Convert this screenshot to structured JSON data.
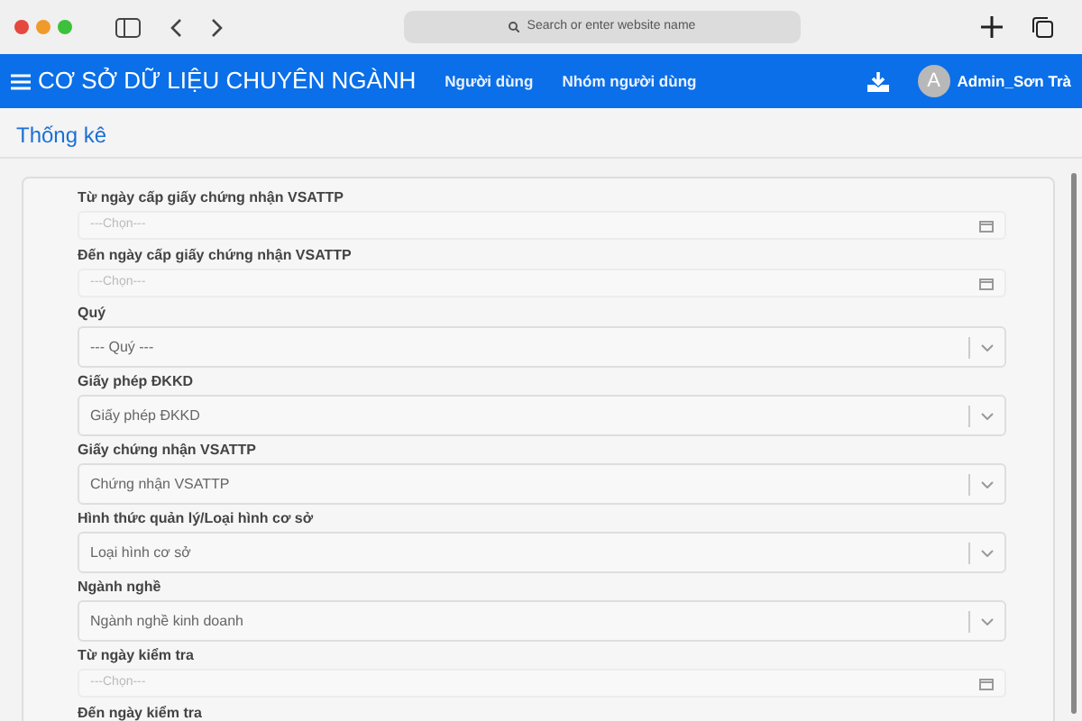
{
  "browser": {
    "address_placeholder": "Search or enter website name"
  },
  "navbar": {
    "title": "CƠ SỞ DỮ LIỆU CHUYÊN NGÀNH",
    "links": [
      "Người dùng",
      "Nhóm người dùng"
    ],
    "user": {
      "initial": "A",
      "name": "Admin_Sơn Trà"
    }
  },
  "page_title": "Thống kê",
  "fields": [
    {
      "label": "Từ ngày cấp giấy chứng nhận VSATTP",
      "kind": "date",
      "placeholder": "---Chọn---"
    },
    {
      "label": "Đến ngày cấp giấy chứng nhận VSATTP",
      "kind": "date",
      "placeholder": "---Chọn---"
    },
    {
      "label": "Quý",
      "kind": "select",
      "placeholder": "--- Quý ---"
    },
    {
      "label": "Giấy phép ĐKKD",
      "kind": "select",
      "placeholder": "Giấy phép ĐKKD"
    },
    {
      "label": "Giấy chứng nhận VSATTP",
      "kind": "select",
      "placeholder": "Chứng nhận VSATTP"
    },
    {
      "label": "Hình thức quản lý/Loại hình cơ sở",
      "kind": "select",
      "placeholder": "Loại hình cơ sở"
    },
    {
      "label": "Ngành nghề",
      "kind": "select",
      "placeholder": "Ngành nghề kinh doanh"
    },
    {
      "label": "Từ ngày kiểm tra",
      "kind": "date",
      "placeholder": "---Chọn---"
    },
    {
      "label": "Đến ngày kiểm tra"
    }
  ]
}
